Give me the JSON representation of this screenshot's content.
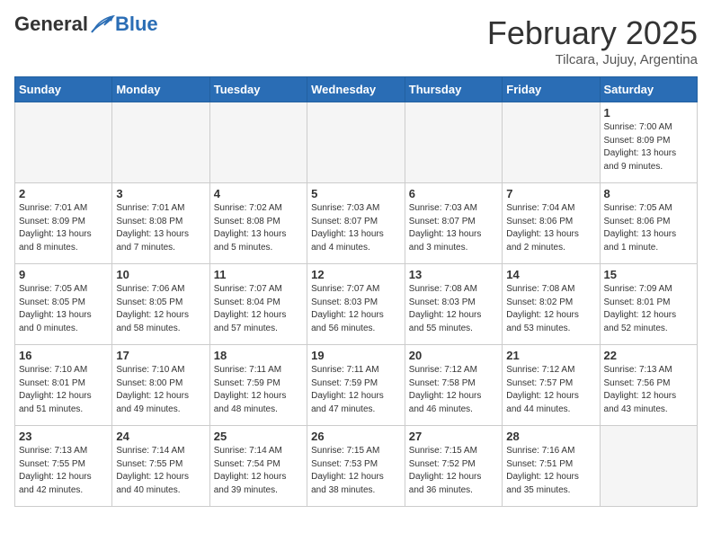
{
  "logo": {
    "general": "General",
    "blue": "Blue"
  },
  "header": {
    "month": "February 2025",
    "location": "Tilcara, Jujuy, Argentina"
  },
  "weekdays": [
    "Sunday",
    "Monday",
    "Tuesday",
    "Wednesday",
    "Thursday",
    "Friday",
    "Saturday"
  ],
  "weeks": [
    [
      {
        "day": "",
        "info": ""
      },
      {
        "day": "",
        "info": ""
      },
      {
        "day": "",
        "info": ""
      },
      {
        "day": "",
        "info": ""
      },
      {
        "day": "",
        "info": ""
      },
      {
        "day": "",
        "info": ""
      },
      {
        "day": "1",
        "info": "Sunrise: 7:00 AM\nSunset: 8:09 PM\nDaylight: 13 hours\nand 9 minutes."
      }
    ],
    [
      {
        "day": "2",
        "info": "Sunrise: 7:01 AM\nSunset: 8:09 PM\nDaylight: 13 hours\nand 8 minutes."
      },
      {
        "day": "3",
        "info": "Sunrise: 7:01 AM\nSunset: 8:08 PM\nDaylight: 13 hours\nand 7 minutes."
      },
      {
        "day": "4",
        "info": "Sunrise: 7:02 AM\nSunset: 8:08 PM\nDaylight: 13 hours\nand 5 minutes."
      },
      {
        "day": "5",
        "info": "Sunrise: 7:03 AM\nSunset: 8:07 PM\nDaylight: 13 hours\nand 4 minutes."
      },
      {
        "day": "6",
        "info": "Sunrise: 7:03 AM\nSunset: 8:07 PM\nDaylight: 13 hours\nand 3 minutes."
      },
      {
        "day": "7",
        "info": "Sunrise: 7:04 AM\nSunset: 8:06 PM\nDaylight: 13 hours\nand 2 minutes."
      },
      {
        "day": "8",
        "info": "Sunrise: 7:05 AM\nSunset: 8:06 PM\nDaylight: 13 hours\nand 1 minute."
      }
    ],
    [
      {
        "day": "9",
        "info": "Sunrise: 7:05 AM\nSunset: 8:05 PM\nDaylight: 13 hours\nand 0 minutes."
      },
      {
        "day": "10",
        "info": "Sunrise: 7:06 AM\nSunset: 8:05 PM\nDaylight: 12 hours\nand 58 minutes."
      },
      {
        "day": "11",
        "info": "Sunrise: 7:07 AM\nSunset: 8:04 PM\nDaylight: 12 hours\nand 57 minutes."
      },
      {
        "day": "12",
        "info": "Sunrise: 7:07 AM\nSunset: 8:03 PM\nDaylight: 12 hours\nand 56 minutes."
      },
      {
        "day": "13",
        "info": "Sunrise: 7:08 AM\nSunset: 8:03 PM\nDaylight: 12 hours\nand 55 minutes."
      },
      {
        "day": "14",
        "info": "Sunrise: 7:08 AM\nSunset: 8:02 PM\nDaylight: 12 hours\nand 53 minutes."
      },
      {
        "day": "15",
        "info": "Sunrise: 7:09 AM\nSunset: 8:01 PM\nDaylight: 12 hours\nand 52 minutes."
      }
    ],
    [
      {
        "day": "16",
        "info": "Sunrise: 7:10 AM\nSunset: 8:01 PM\nDaylight: 12 hours\nand 51 minutes."
      },
      {
        "day": "17",
        "info": "Sunrise: 7:10 AM\nSunset: 8:00 PM\nDaylight: 12 hours\nand 49 minutes."
      },
      {
        "day": "18",
        "info": "Sunrise: 7:11 AM\nSunset: 7:59 PM\nDaylight: 12 hours\nand 48 minutes."
      },
      {
        "day": "19",
        "info": "Sunrise: 7:11 AM\nSunset: 7:59 PM\nDaylight: 12 hours\nand 47 minutes."
      },
      {
        "day": "20",
        "info": "Sunrise: 7:12 AM\nSunset: 7:58 PM\nDaylight: 12 hours\nand 46 minutes."
      },
      {
        "day": "21",
        "info": "Sunrise: 7:12 AM\nSunset: 7:57 PM\nDaylight: 12 hours\nand 44 minutes."
      },
      {
        "day": "22",
        "info": "Sunrise: 7:13 AM\nSunset: 7:56 PM\nDaylight: 12 hours\nand 43 minutes."
      }
    ],
    [
      {
        "day": "23",
        "info": "Sunrise: 7:13 AM\nSunset: 7:55 PM\nDaylight: 12 hours\nand 42 minutes."
      },
      {
        "day": "24",
        "info": "Sunrise: 7:14 AM\nSunset: 7:55 PM\nDaylight: 12 hours\nand 40 minutes."
      },
      {
        "day": "25",
        "info": "Sunrise: 7:14 AM\nSunset: 7:54 PM\nDaylight: 12 hours\nand 39 minutes."
      },
      {
        "day": "26",
        "info": "Sunrise: 7:15 AM\nSunset: 7:53 PM\nDaylight: 12 hours\nand 38 minutes."
      },
      {
        "day": "27",
        "info": "Sunrise: 7:15 AM\nSunset: 7:52 PM\nDaylight: 12 hours\nand 36 minutes."
      },
      {
        "day": "28",
        "info": "Sunrise: 7:16 AM\nSunset: 7:51 PM\nDaylight: 12 hours\nand 35 minutes."
      },
      {
        "day": "",
        "info": ""
      }
    ]
  ]
}
